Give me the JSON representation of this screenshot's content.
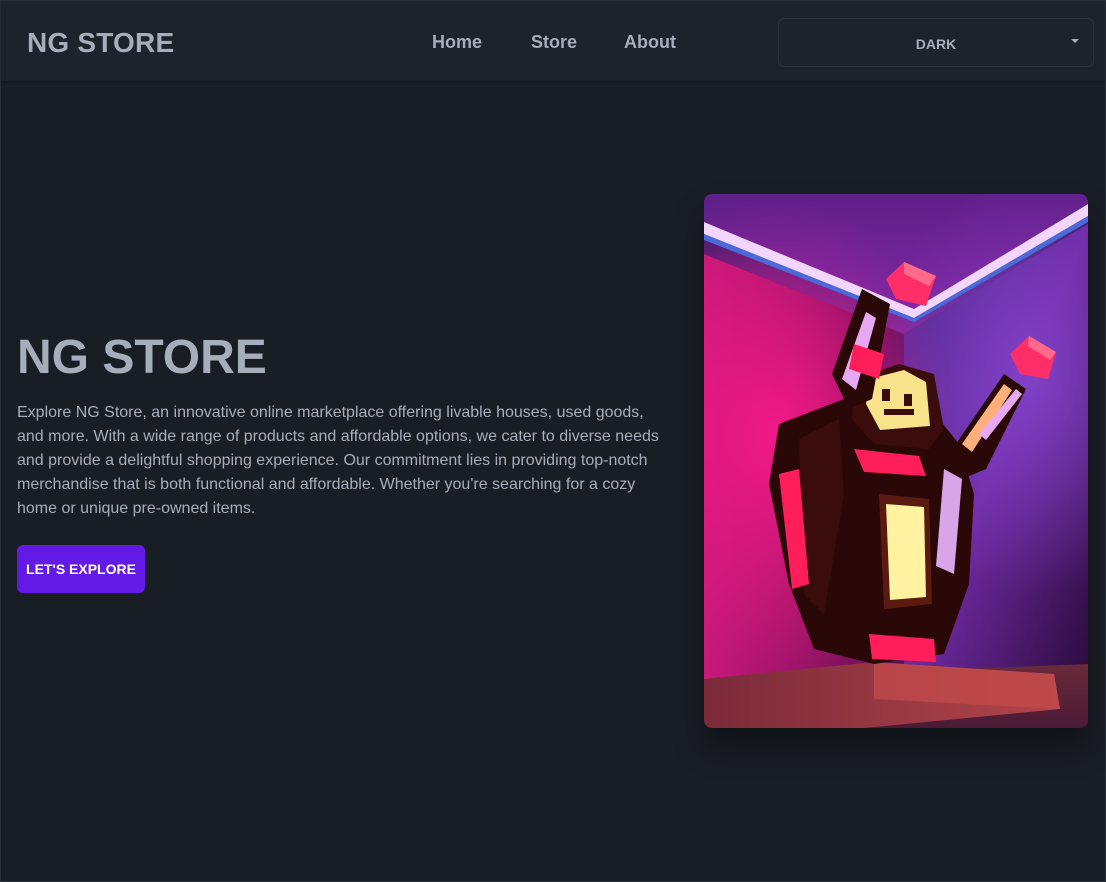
{
  "header": {
    "brand": "NG STORE",
    "nav": [
      {
        "label": "Home"
      },
      {
        "label": "Store"
      },
      {
        "label": "About"
      }
    ],
    "theme_select": {
      "value": "DARK"
    }
  },
  "hero": {
    "title": "NG STORE",
    "description": "Explore NG Store, an innovative online marketplace offering livable houses, used goods, and more. With a wide range of products and affordable options, we cater to diverse needs and provide a delightful shopping experience. Our commitment lies in providing top-notch merchandise that is both functional and affordable. Whether you're searching for a cozy home or unique pre-owned items.",
    "cta_label": "LET'S EXPLORE"
  },
  "colors": {
    "background": "#191e24",
    "navbar": "#1d232a",
    "text": "#a6adbb",
    "primary": "#641ae6"
  }
}
